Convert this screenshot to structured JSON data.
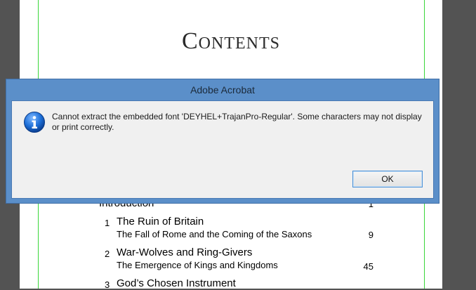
{
  "page": {
    "title": "Contents",
    "toc": [
      {
        "num": "",
        "title": "Introduction",
        "sub": "",
        "page": "1"
      },
      {
        "num": "1",
        "title": "The Ruin of Britain",
        "sub": "The Fall of Rome and the Coming of the Saxons",
        "page": "9"
      },
      {
        "num": "2",
        "title": "War-Wolves and Ring-Givers",
        "sub": "The Emergence of Kings and Kingdoms",
        "page": "45"
      },
      {
        "num": "3",
        "title": "God’s Chosen Instrument",
        "sub": "",
        "page": ""
      }
    ]
  },
  "dialog": {
    "title": "Adobe Acrobat",
    "icon": "info-icon",
    "message": "Cannot extract the embedded font 'DEYHEL+TrajanPro-Regular'. Some characters may not display or print correctly.",
    "ok_label": "OK"
  },
  "colors": {
    "background": "#535353",
    "margin_guide": "#39d639",
    "dialog_frame": "#5b8fc9",
    "info_blue": "#1d6fd8"
  }
}
